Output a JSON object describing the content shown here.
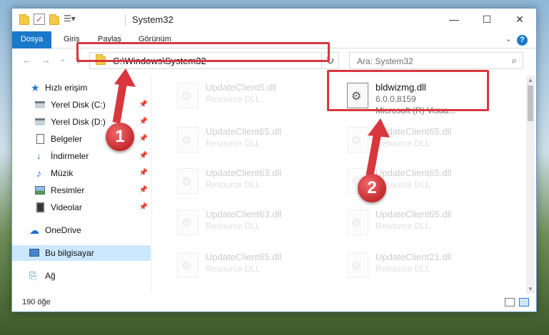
{
  "title_bar": {
    "title": "System32",
    "minimize": "—",
    "maximize": "☐",
    "close": "✕"
  },
  "ribbon": {
    "tabs": [
      {
        "label": "Dosya",
        "active": true
      },
      {
        "label": "Giriş"
      },
      {
        "label": "Paylaş"
      },
      {
        "label": "Görünüm"
      }
    ],
    "help": "?",
    "collapse": "⌄"
  },
  "nav": {
    "back": "←",
    "forward": "→",
    "recent": "⌄",
    "up": "↑",
    "address": "C:\\Windows\\System32",
    "address_drop": "⌄",
    "refresh": "↻",
    "search_placeholder": "Ara: System32",
    "search_icon": "⌕"
  },
  "sidebar": {
    "items": [
      {
        "label": "Hızlı erişim",
        "icon": "star-icon"
      },
      {
        "label": "Yerel Disk (C:)",
        "icon": "disk-icon",
        "pinned": true
      },
      {
        "label": "Yerel Disk (D:)",
        "icon": "disk-icon",
        "pinned": true
      },
      {
        "label": "Belgeler",
        "icon": "document-icon",
        "pinned": true
      },
      {
        "label": "İndirmeler",
        "icon": "download-icon",
        "pinned": true
      },
      {
        "label": "Müzik",
        "icon": "music-icon",
        "pinned": true
      },
      {
        "label": "Resimler",
        "icon": "pictures-icon",
        "pinned": true
      },
      {
        "label": "Videolar",
        "icon": "videos-icon",
        "pinned": true
      },
      {
        "label": "OneDrive",
        "icon": "cloud-icon"
      },
      {
        "label": "Bu bilgisayar",
        "icon": "computer-icon",
        "selected": true
      },
      {
        "label": "Ağ",
        "icon": "network-icon"
      }
    ],
    "pin_glyph": "📌"
  },
  "files": [
    {
      "name": "UpdateClient5.dll",
      "sub": "Resource DLL"
    },
    {
      "name": "bldwizmg.dll",
      "sub": "6.0.0.8159",
      "sub2": "Microsoft (R) Visua...",
      "selected": true
    },
    {
      "name": "UpdateClient65.dll",
      "sub": "Resource DLL"
    },
    {
      "name": "UpdateClient65.dll",
      "sub": "Resource DLL"
    },
    {
      "name": "UpdateClient63.dll",
      "sub": "Resource DLL"
    },
    {
      "name": "UpdateClient65.dll",
      "sub": "Resource DLL"
    },
    {
      "name": "UpdateClient63.dll",
      "sub": "Resource DLL"
    },
    {
      "name": "UpdateClient65.dll",
      "sub": "Resource DLL"
    },
    {
      "name": "UpdateClient65.dll",
      "sub": "Resource DLL"
    },
    {
      "name": "UpdateClient21.dll",
      "sub": "Resource DLL"
    }
  ],
  "status": {
    "count": "190 öğe"
  },
  "annotations": {
    "step1": "1",
    "step2": "2",
    "color": "#d9363e"
  }
}
